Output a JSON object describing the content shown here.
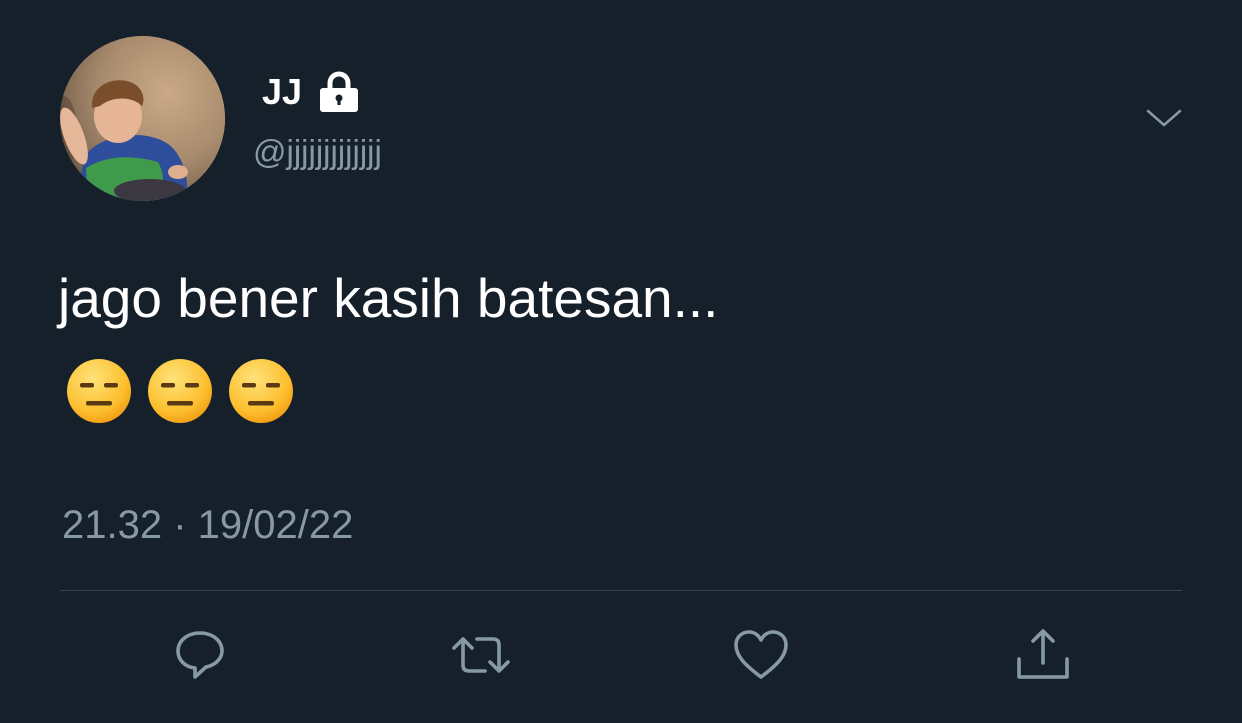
{
  "tweet": {
    "display_name": "JJ",
    "handle": "@jjjjjjjjjjjjj",
    "text": "jago bener kasih batesan...",
    "emojis": [
      "😑",
      "😑",
      "😑"
    ],
    "timestamp": "21.32 · 19/02/22",
    "is_protected": true
  },
  "icons": {
    "lock": "lock-icon",
    "more": "chevron-down-icon",
    "reply": "reply-icon",
    "retweet": "retweet-icon",
    "like": "heart-icon",
    "share": "share-icon"
  },
  "colors": {
    "background": "#15202b",
    "primary_text": "#ffffff",
    "secondary_text": "#8899a6",
    "divider": "#38444d",
    "icon": "#8899a6"
  }
}
